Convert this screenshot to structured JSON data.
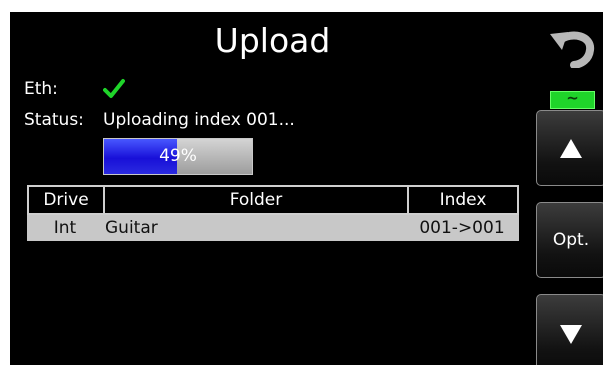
{
  "header": {
    "title": "Upload"
  },
  "eth": {
    "label": "Eth:",
    "status_icon": "checkmark-icon",
    "color": "#1fd42a"
  },
  "status": {
    "label": "Status:",
    "text": "Uploading index 001..."
  },
  "progress": {
    "value": 0.49,
    "text": "49%"
  },
  "table": {
    "columns": [
      "Drive",
      "Folder",
      "Index"
    ],
    "rows": [
      {
        "drive": "Int",
        "folder": "Guitar",
        "index": "001->001"
      }
    ]
  },
  "side_buttons": {
    "back_icon": "undo-icon",
    "connection_icon": "connection-indicator-icon",
    "up_icon": "up-arrow-icon",
    "opt_label": "Opt.",
    "down_icon": "down-arrow-icon"
  }
}
